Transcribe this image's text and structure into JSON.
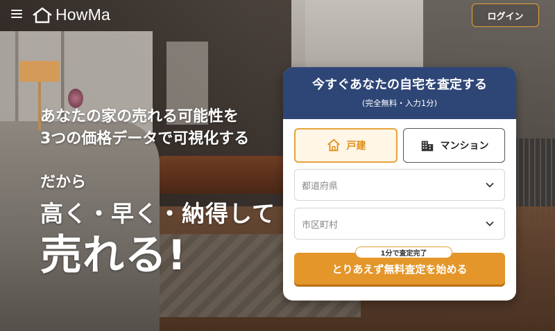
{
  "header": {
    "logo_text": "HowMa",
    "login_label": "ログイン"
  },
  "hero": {
    "line1": "あなたの家の売れる可能性を",
    "line2": "3つの価格データで可視化する",
    "dakara": "だから",
    "big": "高く・早く・納得して",
    "ureru": "売れる!"
  },
  "form": {
    "title": "今すぐあなたの自宅を査定する",
    "subtitle": "(完全無料・入力1分)",
    "types": [
      {
        "label": "戸建",
        "selected": true
      },
      {
        "label": "マンション",
        "selected": false
      }
    ],
    "prefecture_placeholder": "都道府県",
    "city_placeholder": "市区町村",
    "badge": "1分で査定完了",
    "cta_label": "とりあえず無料査定を始める"
  },
  "colors": {
    "accent": "#e4962a",
    "header_navy": "#2e4676"
  }
}
